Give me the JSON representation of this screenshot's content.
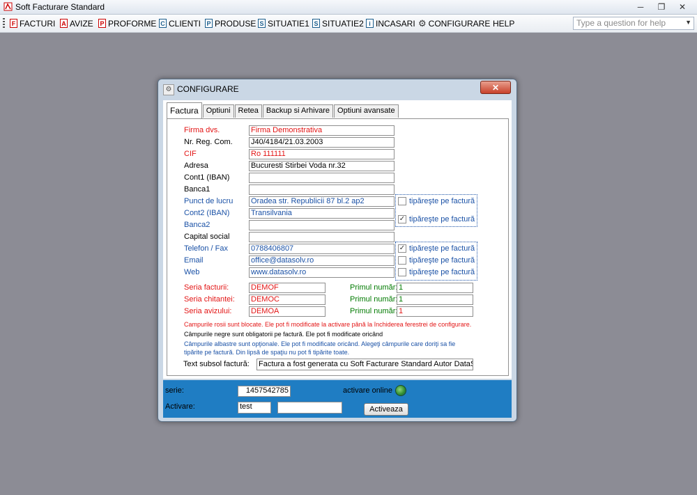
{
  "app": {
    "title": "Soft Facturare Standard",
    "window_buttons": [
      "─",
      "❐",
      "✕"
    ]
  },
  "menu": {
    "items": [
      {
        "label": "FACTURI",
        "icon": "F"
      },
      {
        "label": "AVIZE",
        "icon": "A"
      },
      {
        "label": "PROFORME",
        "icon": "P"
      },
      {
        "label": "CLIENTI",
        "icon": "C"
      },
      {
        "label": "PRODUSE",
        "icon": "P"
      },
      {
        "label": "SITUATIE1",
        "icon": "S"
      },
      {
        "label": "SITUATIE2",
        "icon": "S"
      },
      {
        "label": "INCASARI",
        "icon": "i"
      },
      {
        "label": "CONFIGURARE",
        "icon": "gear-icon"
      },
      {
        "label": "HELP",
        "icon": ""
      }
    ],
    "help_placeholder": "Type a question for help"
  },
  "dialog": {
    "title": "CONFIGURARE",
    "close": "✕",
    "tabs": [
      "Factura",
      "Optiuni",
      "Retea",
      "Backup si Arhivare",
      "Optiuni avansate"
    ],
    "fields": [
      {
        "label": "Firma dvs.",
        "value": "Firma Demonstrativa",
        "color": "red"
      },
      {
        "label": "Nr.  Reg.  Com.",
        "value": "J40/4184/21.03.2003",
        "color": "black"
      },
      {
        "label": "CIF",
        "value": "Ro 111111",
        "color": "red"
      },
      {
        "label": "Adresa",
        "value": "Bucuresti Stirbei Voda nr.32",
        "color": "black"
      },
      {
        "label": "Cont1 (IBAN)",
        "value": "",
        "color": "black"
      },
      {
        "label": "Banca1",
        "value": "",
        "color": "black"
      },
      {
        "label": "Punct de lucru",
        "value": "Oradea str. Republicii 87 bl.2 ap2",
        "color": "blue"
      },
      {
        "label": "Cont2 (IBAN)",
        "value": "Transilvania",
        "color": "blue"
      },
      {
        "label": "Banca2",
        "value": "",
        "color": "blue"
      },
      {
        "label": "Capital social",
        "value": "",
        "color": "black"
      },
      {
        "label": "Telefon / Fax",
        "value": "0788406807",
        "color": "blue"
      },
      {
        "label": "Email",
        "value": "office@datasolv.ro",
        "color": "blue"
      },
      {
        "label": "Web",
        "value": "www.datasolv.ro",
        "color": "blue"
      }
    ],
    "print_label": "tipăreşte pe factură",
    "print_checks": {
      "punct_de_lucru": false,
      "banca2": true,
      "telefon": true,
      "email": false,
      "web": false
    },
    "series": [
      {
        "label": "Seria facturii:",
        "value": "DEMOF",
        "num_label": "Primul număr:",
        "num": "1"
      },
      {
        "label": "Seria chitantei:",
        "value": "DEMOC",
        "num_label": "Primul număr:",
        "num": "1"
      },
      {
        "label": "Seria avizului:",
        "value": "DEMOA",
        "num_label": "Primul număr:",
        "num": "1"
      }
    ],
    "notes": {
      "red": "Campurile rosii sunt blocate. Ele pot fi modificate  la activare până la închiderea ferestrei de configurare.",
      "black": "Câmpurile negre sunt obligatorii pe factură. Ele pot fi modificate oricând",
      "blue1": "Câmpurile albastre sunt opţionale. Ele pot fi modificate oricând. Alegeţi câmpurile care doriţi sa fie",
      "blue2": "tipărite pe factură. Din lipsă de spaţiu nu pot fi tipărite toate."
    },
    "footer_text": {
      "label": "Text subsol factură:",
      "value": "Factura a fost generata cu Soft Facturare Standard Autor DataSo"
    },
    "activation": {
      "serie_label": "serie:",
      "serie_value": "1457542785",
      "online_label": "activare online",
      "activare_label": "Activare:",
      "activare_value": "test",
      "activare_value2": "",
      "button": "Activeaza"
    }
  }
}
